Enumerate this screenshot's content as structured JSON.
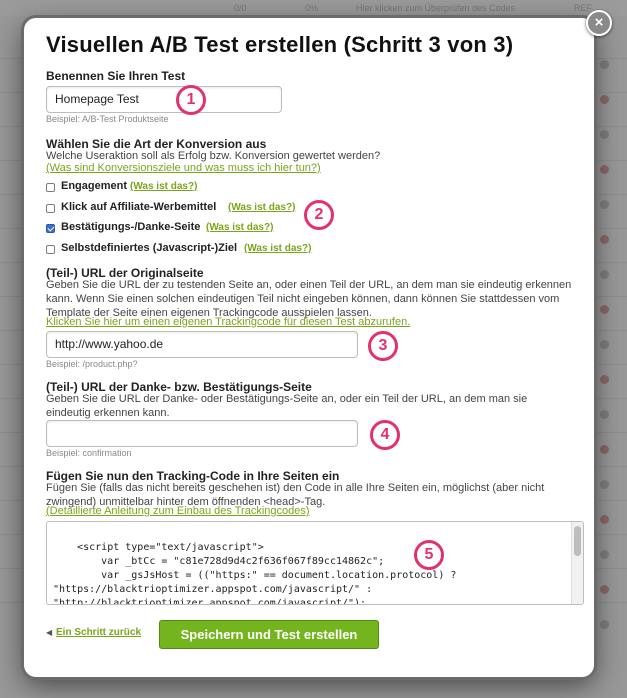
{
  "background": {
    "cells": [
      "0/0",
      "0%",
      "Hier klicken zum Überprüfen des Codes",
      "REF"
    ]
  },
  "modal": {
    "title": "Visuellen A/B Test erstellen (Schritt 3 von 3)",
    "close_icon": "×",
    "name_section": {
      "label": "Benennen Sie Ihren Test",
      "value": "Homepage Test",
      "hint": "Beispiel: A/B-Test Produktseite"
    },
    "conversion_section": {
      "label": "Wählen Sie die Art der Konversion aus",
      "question": "Welche Useraktion soll als Erfolg bzw. Konversion gewertet werden?",
      "help_link": "(Was sind Konversionsziele und was muss ich hier tun?)",
      "options": [
        {
          "label": "Engagement",
          "link": "(Was ist das?)",
          "checked": false
        },
        {
          "label": "Klick auf Affiliate-Werbemittel",
          "link": "(Was ist das?)",
          "checked": false
        },
        {
          "label": "Bestätigungs-/Danke-Seite",
          "link": "(Was ist das?)",
          "checked": true
        },
        {
          "label": "Selbstdefiniertes (Javascript-)Ziel",
          "link": "(Was ist das?)",
          "checked": false
        }
      ]
    },
    "original_url_section": {
      "label": "(Teil-) URL der Originalseite",
      "description": "Geben Sie die URL der zu testenden Seite an, oder einen Teil der URL, an dem man sie eindeutig erkennen kann. Wenn Sie einen solchen eindeutigen Teil nicht eingeben können, dann können Sie stattdessen vom Template der Seite einen eigenen Trackingcode ausspielen lassen.",
      "link": "Klicken Sie hier um einen eigenen Trackingcode für diesen Test abzurufen.",
      "value": "http://www.yahoo.de",
      "hint": "Beispiel: /product.php?"
    },
    "thanks_url_section": {
      "label": "(Teil-) URL der Danke- bzw. Bestätigungs-Seite",
      "description": "Geben Sie die URL der Danke- oder Bestätigungs-Seite an, oder ein Teil der URL, an dem man sie eindeutig erkennen kann.",
      "value": "",
      "hint": "Beispiel: confirmation"
    },
    "tracking_section": {
      "label": "Fügen Sie nun den Tracking-Code in Ihre Seiten ein",
      "description": "Fügen Sie (falls das nicht bereits geschehen ist) den Code in alle Ihre Seiten ein, möglichst (aber nicht zwingend) unmittelbar hinter dem öffnenden <head>-Tag.",
      "link": "(Detaillierte Anleitung zum Einbau des Trackingcodes)",
      "code": "<script type=\"text/javascript\">\n        var _btCc = \"c81e728d9d4c2f636f067f89cc14862c\";\n        var _gsJsHost = ((\"https:\" == document.location.protocol) ?\n\"https://blacktrioptimizer.appspot.com/javascript/\" :\n\"http://blacktrioptimizer.appspot.com/javascript/\");\n        document.write('<scr' + 'ipt type=\"text/javascript\" src=\"' +_gsJsHost+'gs.js\"></scr'+'ipt>');"
    },
    "footer": {
      "back_icon": "◀",
      "back_label": "Ein Schritt zurück",
      "submit_label": "Speichern und Test erstellen"
    },
    "annotations": [
      "1",
      "2",
      "3",
      "4",
      "5"
    ]
  },
  "colors": {
    "accent_green": "#7aa51b",
    "button_green": "#74b51f",
    "annotation_pink": "#e3306f"
  }
}
